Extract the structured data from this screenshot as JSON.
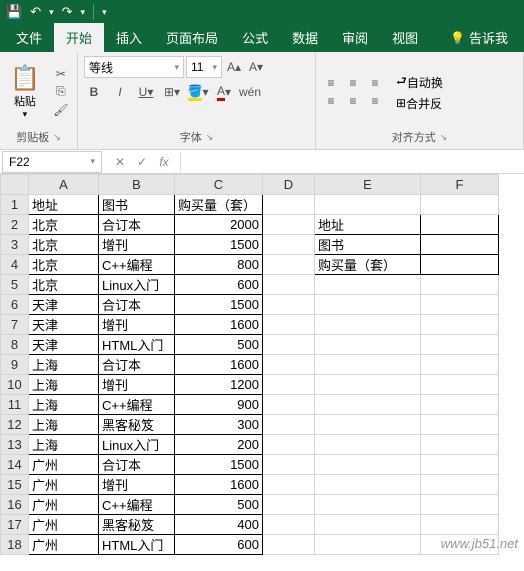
{
  "qat": {
    "save": "💾",
    "undo": "↶",
    "redo": "↷"
  },
  "tabs": {
    "file": "文件",
    "home": "开始",
    "insert": "插入",
    "layout": "页面布局",
    "formulas": "公式",
    "data": "数据",
    "review": "审阅",
    "view": "视图",
    "tell": "告诉我"
  },
  "ribbon": {
    "clipboard": {
      "paste": "粘贴",
      "group": "剪贴板"
    },
    "font": {
      "name": "等线",
      "size": "11",
      "group": "字体",
      "bold": "B",
      "italic": "I",
      "underline": "U",
      "wen": "wén"
    },
    "align": {
      "wrap": "自动换",
      "merge": "合并反",
      "group": "对齐方式"
    }
  },
  "nameBox": "F22",
  "fx": "fx",
  "columns": [
    "A",
    "B",
    "C",
    "D",
    "E",
    "F"
  ],
  "rows": [
    {
      "r": "1",
      "a": "地址",
      "b": "图书",
      "c": "购买量（套）",
      "d": "",
      "e": "",
      "f": "",
      "cNum": false
    },
    {
      "r": "2",
      "a": "北京",
      "b": "合订本",
      "c": "2000",
      "d": "",
      "e": "地址",
      "f": ""
    },
    {
      "r": "3",
      "a": "北京",
      "b": "增刊",
      "c": "1500",
      "d": "",
      "e": "图书",
      "f": ""
    },
    {
      "r": "4",
      "a": "北京",
      "b": "C++编程",
      "c": "800",
      "d": "",
      "e": "购买量（套）",
      "f": ""
    },
    {
      "r": "5",
      "a": "北京",
      "b": "Linux入门",
      "c": "600",
      "d": "",
      "e": "",
      "f": ""
    },
    {
      "r": "6",
      "a": "天津",
      "b": "合订本",
      "c": "1500",
      "d": "",
      "e": "",
      "f": ""
    },
    {
      "r": "7",
      "a": "天津",
      "b": "增刊",
      "c": "1600",
      "d": "",
      "e": "",
      "f": ""
    },
    {
      "r": "8",
      "a": "天津",
      "b": "HTML入门",
      "c": "500",
      "d": "",
      "e": "",
      "f": ""
    },
    {
      "r": "9",
      "a": "上海",
      "b": "合订本",
      "c": "1600",
      "d": "",
      "e": "",
      "f": ""
    },
    {
      "r": "10",
      "a": "上海",
      "b": "增刊",
      "c": "1200",
      "d": "",
      "e": "",
      "f": ""
    },
    {
      "r": "11",
      "a": "上海",
      "b": "C++编程",
      "c": "900",
      "d": "",
      "e": "",
      "f": ""
    },
    {
      "r": "12",
      "a": "上海",
      "b": "黑客秘笈",
      "c": "300",
      "d": "",
      "e": "",
      "f": ""
    },
    {
      "r": "13",
      "a": "上海",
      "b": "Linux入门",
      "c": "200",
      "d": "",
      "e": "",
      "f": ""
    },
    {
      "r": "14",
      "a": "广州",
      "b": "合订本",
      "c": "1500",
      "d": "",
      "e": "",
      "f": ""
    },
    {
      "r": "15",
      "a": "广州",
      "b": "增刊",
      "c": "1600",
      "d": "",
      "e": "",
      "f": ""
    },
    {
      "r": "16",
      "a": "广州",
      "b": "C++编程",
      "c": "500",
      "d": "",
      "e": "",
      "f": ""
    },
    {
      "r": "17",
      "a": "广州",
      "b": "黑客秘笈",
      "c": "400",
      "d": "",
      "e": "",
      "f": ""
    },
    {
      "r": "18",
      "a": "广州",
      "b": "HTML入门",
      "c": "600",
      "d": "",
      "e": "",
      "f": ""
    }
  ],
  "watermark": "www.jb51.net"
}
